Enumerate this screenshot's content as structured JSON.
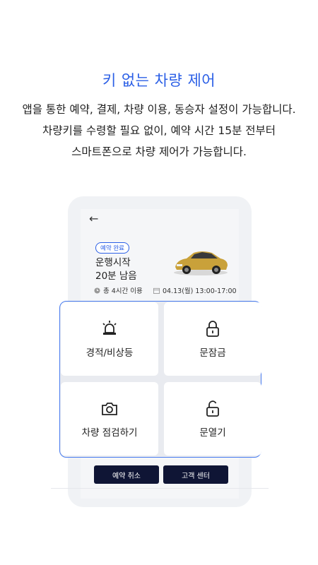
{
  "header": {
    "title": "키 없는 차량 제어",
    "lines": [
      "앱을 통한 예약, 결제, 차량 이용, 동승자 설정이 가능합니다.",
      "차량키를 수령할 필요 없이, 예약 시간 15분 전부터",
      "스마트폰으로 차량 제어가 가능합니다."
    ]
  },
  "phone": {
    "badge": "예약 완료",
    "status_line1": "운행시작",
    "status_line2": "20분 남음",
    "usage": "총 4시간 이용",
    "date": "04.13(월) 13:00-17:00"
  },
  "controls": [
    {
      "label": "경적/비상등",
      "icon": "siren-icon"
    },
    {
      "label": "문잠금",
      "icon": "lock-icon"
    },
    {
      "label": "차량 점검하기",
      "icon": "camera-icon"
    },
    {
      "label": "문열기",
      "icon": "unlock-icon"
    }
  ],
  "buttons": {
    "cancel": "예약 취소",
    "support": "고객 센터"
  },
  "colors": {
    "accent": "#2b5fe6",
    "button_bg": "#0f1535",
    "panel_border": "#4a7df0"
  }
}
